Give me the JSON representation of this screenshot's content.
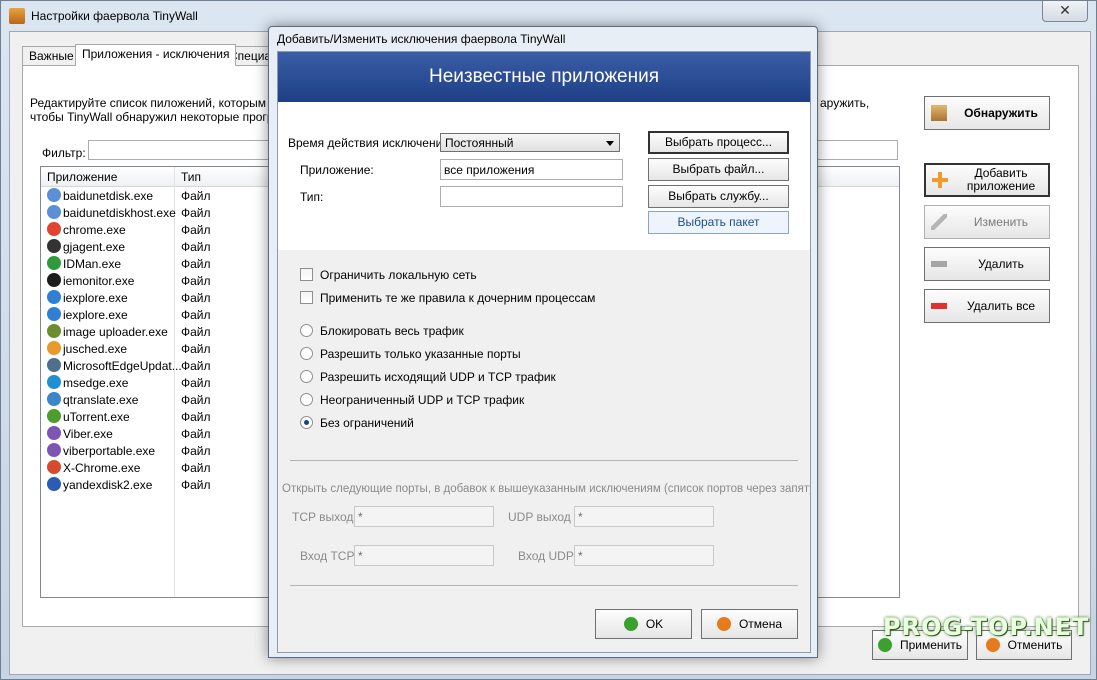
{
  "main": {
    "title": "Настройки фаервола TinyWall",
    "close": "✕",
    "tabs": [
      "Важные",
      "Приложения - исключения",
      "Специал"
    ],
    "description_line1": "Редактируйте список пиложений, которым в",
    "description_line2": "чтобы TinyWall обнаружил некоторые програ",
    "description_right": "аружить,",
    "filter_label": "Фильтр:",
    "list": {
      "col_app": "Приложение",
      "col_type": "Тип",
      "rows": [
        {
          "name": "baidunetdisk.exe",
          "type": "Файл"
        },
        {
          "name": "baidunetdiskhost.exe",
          "type": "Файл"
        },
        {
          "name": "chrome.exe",
          "type": "Файл"
        },
        {
          "name": "gjagent.exe",
          "type": "Файл"
        },
        {
          "name": "IDMan.exe",
          "type": "Файл"
        },
        {
          "name": "iemonitor.exe",
          "type": "Файл"
        },
        {
          "name": "iexplore.exe",
          "type": "Файл"
        },
        {
          "name": "iexplore.exe",
          "type": "Файл"
        },
        {
          "name": "image uploader.exe",
          "type": "Файл"
        },
        {
          "name": "jusched.exe",
          "type": "Файл"
        },
        {
          "name": "MicrosoftEdgeUpdat...",
          "type": "Файл"
        },
        {
          "name": "msedge.exe",
          "type": "Файл"
        },
        {
          "name": "qtranslate.exe",
          "type": "Файл"
        },
        {
          "name": "uTorrent.exe",
          "type": "Файл"
        },
        {
          "name": "Viber.exe",
          "type": "Файл"
        },
        {
          "name": "viberportable.exe",
          "type": "Файл"
        },
        {
          "name": "X-Chrome.exe",
          "type": "Файл"
        },
        {
          "name": "yandexdisk2.exe",
          "type": "Файл"
        }
      ]
    },
    "side_buttons": {
      "detect": "Обнаружить",
      "add": "Добавить приложение",
      "edit": "Изменить",
      "delete": "Удалить",
      "delete_all": "Удалить все"
    },
    "apply": "Применить",
    "cancel": "Отменить",
    "watermark": "PROG-TOP.NET"
  },
  "dialog": {
    "title": "Добавить/Изменить исключения фаервола TinyWall",
    "banner": "Неизвестные приложения",
    "duration_label": "Время действия исключения",
    "duration_value": "Постоянный",
    "app_label": "Приложение:",
    "app_value": "все приложения",
    "type_label": "Тип:",
    "type_value": "",
    "btn_process": "Выбрать процесс...",
    "btn_file": "Выбрать файл...",
    "btn_service": "Выбрать службу...",
    "btn_package": "Выбрать пакет",
    "chk_local": "Ограничить локальную сеть",
    "chk_child": "Применить те же правила к дочерним процессам",
    "radio_block": "Блокировать весь трафик",
    "radio_ports": "Разрешить только указанные порты",
    "radio_outgoing": "Разрешить исходящий UDP и TCP трафик",
    "radio_unlimited": "Неограниченный UDP и TCP трафик",
    "radio_none": "Без ограничений",
    "ports_hint": "Открыть следующие порты, в добавок к вышеуказанным исключениям (список портов через запятую)",
    "tcp_out_label": "TCP выход",
    "tcp_out_value": "*",
    "udp_out_label": "UDP выход",
    "udp_out_value": "*",
    "tcp_in_label": "Вход TCP",
    "tcp_in_value": "*",
    "udp_in_label": "Вход UDP",
    "udp_in_value": "*",
    "ok": "OK",
    "cancel": "Отмена"
  },
  "colors": {
    "banner": "#2a4b95",
    "ok_dot": "#3aa12f",
    "cancel_dot": "#e87a1e"
  }
}
